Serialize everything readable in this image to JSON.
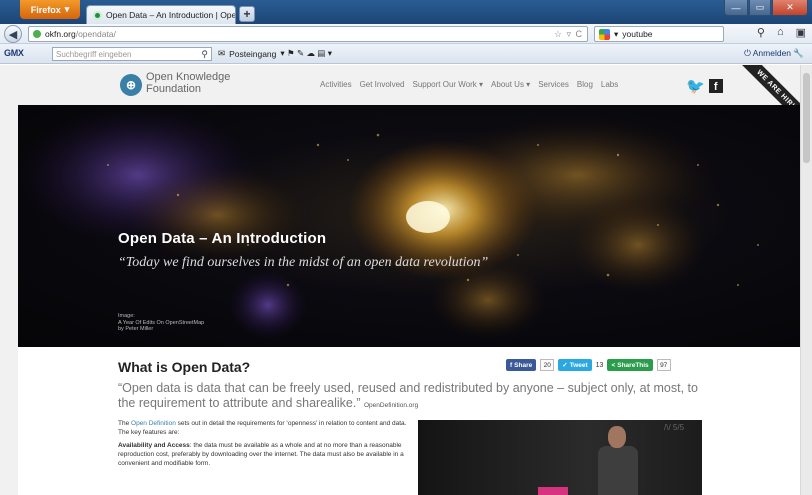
{
  "browser": {
    "app_button": "Firefox",
    "tab_title": "Open Data – An Introduction | Open Kno...",
    "new_tab": "+",
    "url_host": "okfn.org",
    "url_path": "/opendata/",
    "url_right": "☆ ▿ C",
    "search_value": "youtube",
    "win_min": "—",
    "win_max": "▭",
    "win_close": "✕"
  },
  "toolbar": {
    "gmx_logo": "GMX",
    "gmx_placeholder": "Suchbegriff eingeben",
    "posteingang": "Posteingang",
    "anmelden": "Anmelden"
  },
  "site": {
    "name": "Open Knowledge Foundation",
    "nav": [
      "Activities",
      "Get Involved",
      "Support Our Work ▾",
      "About Us ▾",
      "Services",
      "Blog",
      "Labs"
    ],
    "ribbon": "WE ARE HIRING!",
    "hero_title": "Open Data – An Introduction",
    "hero_quote": "“Today we find ourselves in the midst of an open data revolution”",
    "credit_l1": "Image:",
    "credit_l2": "A Year Of Edits On OpenStreetMap",
    "credit_l3": "by Peter Miller",
    "section_title": "What is Open Data?",
    "share": {
      "fb_label": "Share",
      "fb_count": "20",
      "tw_label": "Tweet",
      "tw_count": "13",
      "sh_label": "ShareThis",
      "sh_count": "97"
    },
    "quote": "“Open data is data that can be freely used, reused and redistributed by anyone – subject only, at most, to the requirement to attribute and sharealike.”",
    "quote_source": "OpenDefinition.org",
    "p1_prefix": "The ",
    "p1_link": "Open Definition",
    "p1_rest": " sets out in detail the requirements for ‘openness’ in relation to content and data. The key features are:",
    "p2_bold": "Availability and Access",
    "p2_rest": ": the data must be available as a whole and at no more than a reasonable reproduction cost, preferably by downloading over the internet. The data must also be available in a convenient and modifiable form.",
    "video_slide": "/\\/ 5/5"
  },
  "colors": {
    "accent": "#3a7fa8",
    "facebook": "#3b5998",
    "twitter": "#2ba7e1",
    "sharethis": "#2a9d4c"
  },
  "icons": [
    "back-arrow-icon",
    "site-identity-icon",
    "bookmark-star-icon",
    "google-icon",
    "search-icon",
    "home-icon",
    "twitter-icon",
    "facebook-icon",
    "magnifier-icon"
  ]
}
